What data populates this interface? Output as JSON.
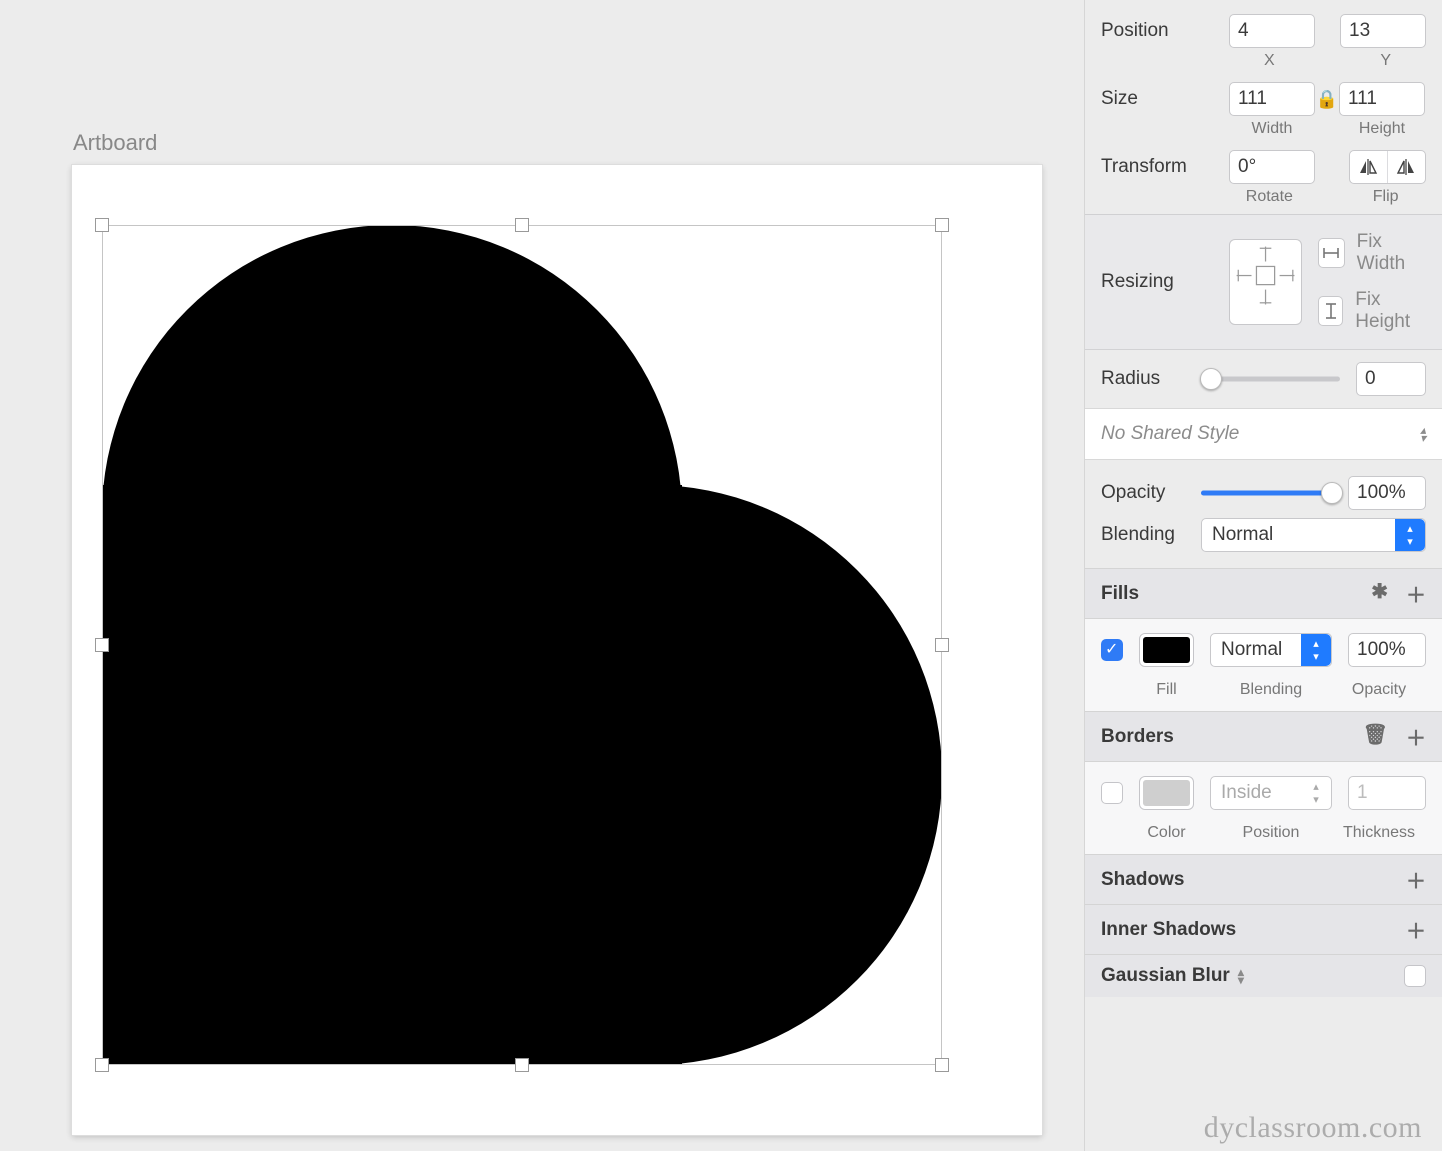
{
  "canvas": {
    "artboard_label": "Artboard"
  },
  "inspector": {
    "position": {
      "label": "Position",
      "x": "4",
      "y": "13",
      "x_caption": "X",
      "y_caption": "Y"
    },
    "size": {
      "label": "Size",
      "width": "111",
      "height": "111",
      "w_caption": "Width",
      "h_caption": "Height"
    },
    "transform": {
      "label": "Transform",
      "rotate": "0°",
      "rotate_caption": "Rotate",
      "flip_caption": "Flip"
    },
    "resizing": {
      "label": "Resizing",
      "fix_width": "Fix Width",
      "fix_height": "Fix Height"
    },
    "radius": {
      "label": "Radius",
      "value": "0"
    },
    "shared_style": {
      "text": "No Shared Style"
    },
    "opacity": {
      "label": "Opacity",
      "value": "100%"
    },
    "blending": {
      "label": "Blending",
      "value": "Normal"
    },
    "fills": {
      "title": "Fills",
      "row": {
        "checked": true,
        "color": "#000000",
        "blend": "Normal",
        "opacity": "100%"
      },
      "captions": {
        "fill": "Fill",
        "blending": "Blending",
        "opacity": "Opacity"
      }
    },
    "borders": {
      "title": "Borders",
      "row": {
        "checked": false,
        "color": "#cfcfcf",
        "position": "Inside",
        "thickness": "1"
      },
      "captions": {
        "color": "Color",
        "position": "Position",
        "thickness": "Thickness"
      }
    },
    "shadows": {
      "title": "Shadows"
    },
    "inner_shadows": {
      "title": "Inner Shadows"
    },
    "gaussian_blur": {
      "title": "Gaussian Blur"
    }
  },
  "watermark": "dyclassroom.com"
}
